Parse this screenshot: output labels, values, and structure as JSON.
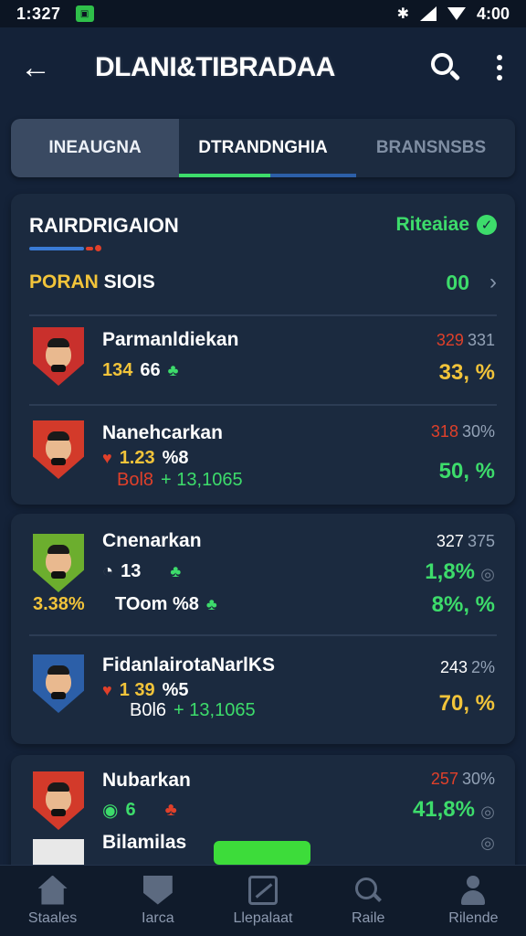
{
  "status_bar": {
    "time": "1:327",
    "clock": "4:00"
  },
  "header": {
    "title": "DLANI&TIBRADAA"
  },
  "tabs": [
    {
      "label": "INEAUGNA"
    },
    {
      "label": "DTRANDNGHIA"
    },
    {
      "label": "BRANSNSBS"
    }
  ],
  "section": {
    "title": "RAIRDRIGAION",
    "status_label": "Riteaiae",
    "filter_label_hl": "PORAN",
    "filter_label_rest": " SIOIS",
    "filter_count": "00"
  },
  "rows": [
    {
      "name": "Parmanldiekan",
      "sub1": "134",
      "sub2": "66",
      "pct_a": "329",
      "pct_b": "331",
      "big": "33, %",
      "big_color": "yellow",
      "crest_color": "#c9302c"
    },
    {
      "name": "Nanehcarkan",
      "sub1": "1.23",
      "sub2": "%8",
      "extra_a": "Bol8",
      "extra_b": "+ 13,1065",
      "pct_a": "318",
      "pct_b": "30%",
      "big": "50, %",
      "big_color": "green",
      "crest_color": "#d33a2a"
    },
    {
      "name": "Cnenarkan",
      "sub1": "13",
      "side": "3.38%",
      "line2": "TOom %8",
      "pct_a": "327",
      "pct_b": "375",
      "big_top": "1,8%",
      "big": "8%, %",
      "big_color": "green",
      "crest_color": "#6cae2e"
    },
    {
      "name": "FidanlairotaNarlKS",
      "sub1": "1 39",
      "sub2": "%5",
      "extra_a": "B0l6",
      "extra_b": "+ 13,1065",
      "pct_a": "243",
      "pct_b": "2%",
      "big": "70, %",
      "big_color": "yellow",
      "crest_color": "#2c5fa8"
    },
    {
      "name": "Nubarkan",
      "sub1": "6",
      "pct_a": "257",
      "pct_b": "30%",
      "big": "41,8%",
      "big_color": "green",
      "crest_color": "#d33a2a"
    },
    {
      "name": "Bilamilas"
    }
  ],
  "nav": [
    {
      "label": "Staales",
      "icon": "home-icon"
    },
    {
      "label": "Iarca",
      "icon": "shield-icon"
    },
    {
      "label": "Llepalaat",
      "icon": "chart-icon"
    },
    {
      "label": "Raile",
      "icon": "search-icon"
    },
    {
      "label": "Rilende",
      "icon": "user-icon"
    }
  ],
  "colors": {
    "accent_green": "#3ddc6b",
    "accent_yellow": "#f2c43a",
    "accent_red": "#e0402a",
    "bg": "#142238"
  }
}
